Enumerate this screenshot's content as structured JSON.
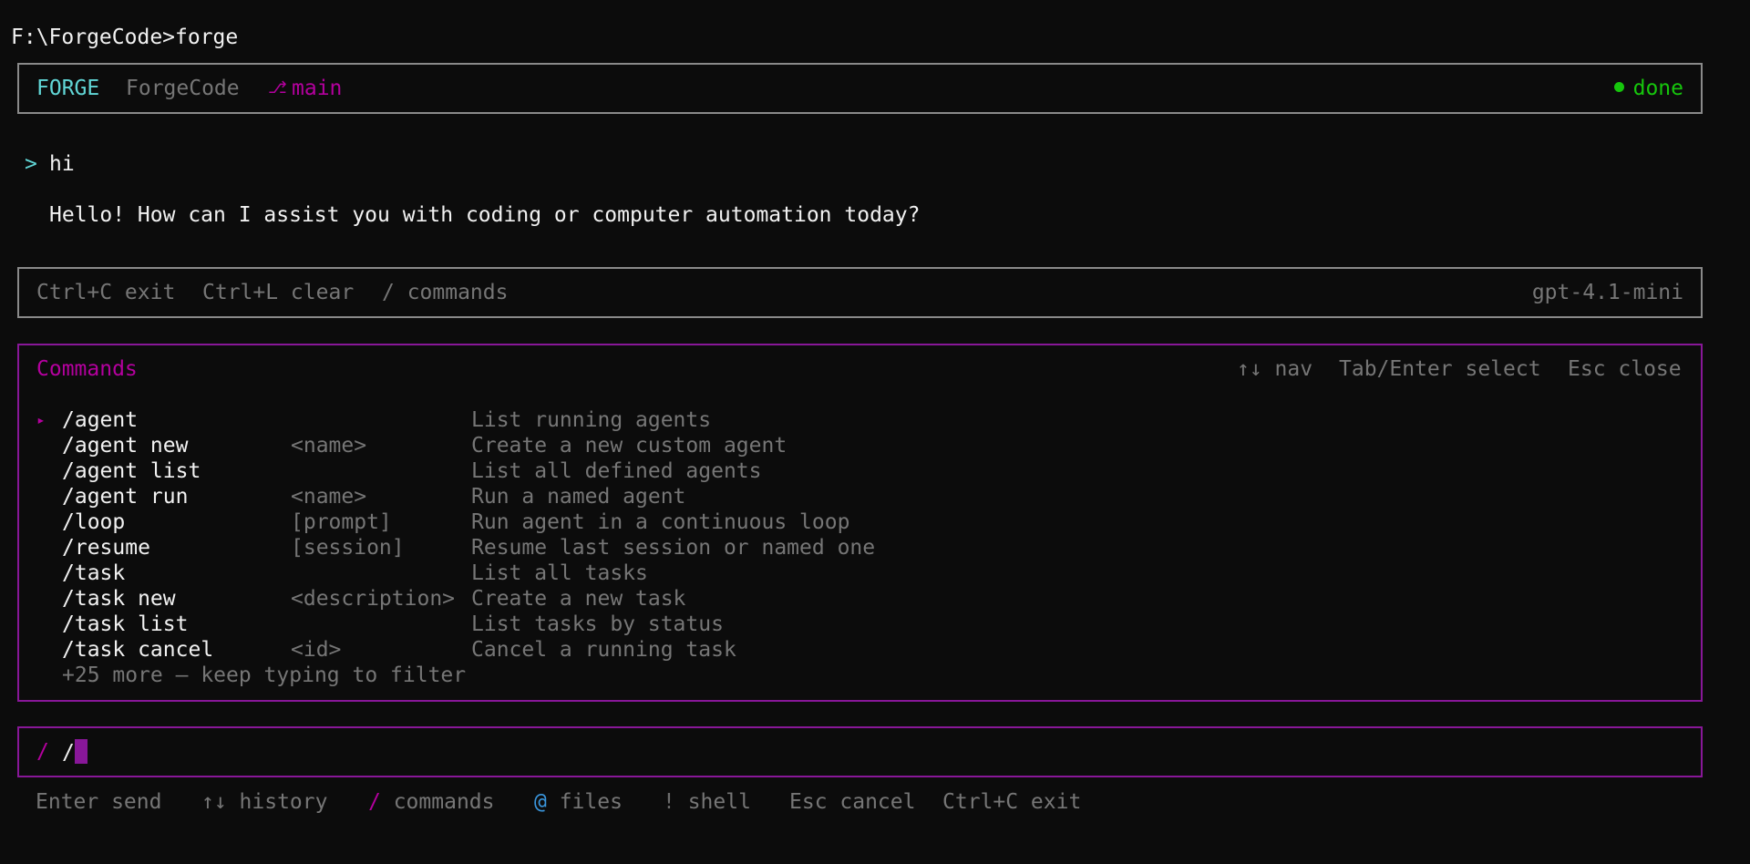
{
  "terminal": {
    "prompt_line": "F:\\ForgeCode>forge"
  },
  "header": {
    "brand": "FORGE",
    "project": "ForgeCode",
    "branch_icon": "git-branch-icon",
    "branch_glyph": "⎇",
    "branch": "main",
    "status_icon": "status-dot-icon",
    "status": "done",
    "colors": {
      "brand": "#61d6d6",
      "branch": "#b4009e",
      "status": "#16c60c"
    }
  },
  "conversation": {
    "user_marker": ">",
    "user_message": "hi",
    "assistant_message": "Hello! How can I assist you with coding or computer automation today?"
  },
  "hints": {
    "items": [
      "Ctrl+C exit",
      "Ctrl+L clear",
      "/ commands"
    ],
    "model": "gpt-4.1-mini"
  },
  "commands_panel": {
    "title": "Commands",
    "nav_hints": [
      "↑↓ nav",
      "Tab/Enter select",
      "Esc close"
    ],
    "selected_marker": "▸",
    "items": [
      {
        "command": "/agent",
        "arg": "",
        "description": "List running agents",
        "selected": true
      },
      {
        "command": "/agent new",
        "arg": "<name>",
        "description": "Create a new custom agent"
      },
      {
        "command": "/agent list",
        "arg": "",
        "description": "List all defined agents"
      },
      {
        "command": "/agent run",
        "arg": "<name>",
        "description": "Run a named agent"
      },
      {
        "command": "/loop",
        "arg": "[prompt]",
        "description": "Run agent in a continuous loop"
      },
      {
        "command": "/resume",
        "arg": "[session]",
        "description": "Resume last session or named one"
      },
      {
        "command": "/task",
        "arg": "",
        "description": "List all tasks"
      },
      {
        "command": "/task new",
        "arg": "<description>",
        "description": "Create a new task"
      },
      {
        "command": "/task list",
        "arg": "",
        "description": "List tasks by status"
      },
      {
        "command": "/task cancel",
        "arg": "<id>",
        "description": "Cancel a running task"
      }
    ],
    "more_text": "+25 more — keep typing to filter",
    "accent_color": "#881798"
  },
  "input": {
    "prompt_symbol": "/",
    "value": "/"
  },
  "footer": {
    "enter": "Enter send",
    "history": "↑↓ history",
    "commands_key": "/",
    "commands_label": " commands",
    "files_key": "@",
    "files_label": " files",
    "shell_key": "!",
    "shell_label": " shell",
    "cancel": "Esc cancel",
    "exit": "Ctrl+C exit"
  }
}
